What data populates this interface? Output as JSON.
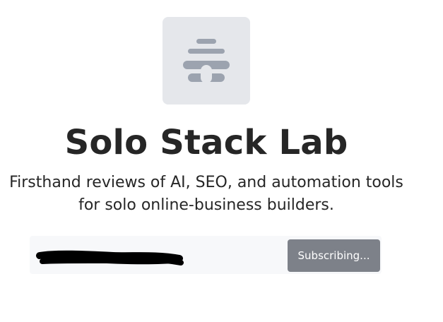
{
  "logo": {
    "icon": "beehive-icon",
    "background_color": "#e5e7eb",
    "icon_color": "#9ca3af"
  },
  "header": {
    "title": "Solo Stack Lab",
    "subtitle": "Firsthand reviews of AI, SEO, and automation tools for solo online-business builders."
  },
  "subscribe_form": {
    "email_value": "",
    "email_redacted": true,
    "button_label": "Subscribing...",
    "button_color": "#7d8189"
  }
}
